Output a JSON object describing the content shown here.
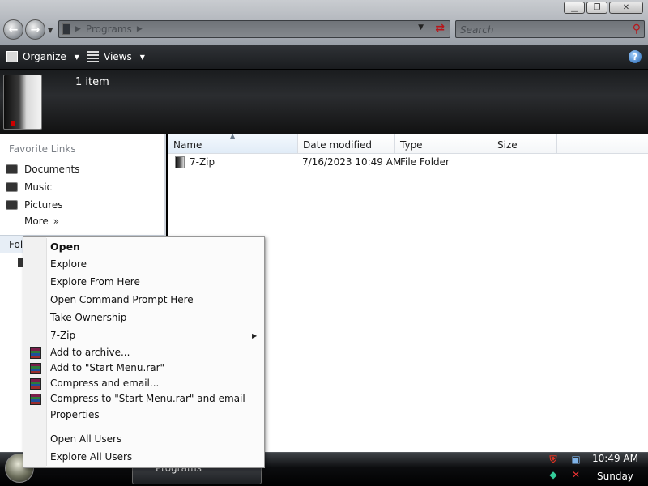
{
  "address": {
    "path": [
      "Programs"
    ],
    "search_placeholder": "Search"
  },
  "window_buttons": [
    "minimize",
    "restore",
    "close"
  ],
  "toolbar": {
    "organize_label": "Organize",
    "views_label": "Views"
  },
  "details": {
    "item_count": "1 item"
  },
  "navpane": {
    "favorites_title": "Favorite Links",
    "favorites": [
      {
        "label": "Documents",
        "icon": "documents-icon"
      },
      {
        "label": "Music",
        "icon": "music-icon"
      },
      {
        "label": "Pictures",
        "icon": "pictures-icon"
      }
    ],
    "more_label": "More",
    "more_glyph": "»",
    "folders_label": "Fol"
  },
  "filelist": {
    "columns": [
      "Name",
      "Date modified",
      "Type",
      "Size"
    ],
    "rows": [
      {
        "name": "7-Zip",
        "date_modified": "7/16/2023 10:49 AM",
        "type": "File Folder",
        "size": ""
      }
    ]
  },
  "context_menu": {
    "items": [
      {
        "label": "Open",
        "bold": true
      },
      {
        "label": "Explore"
      },
      {
        "label": "Explore From Here"
      },
      {
        "label": "Open Command Prompt Here"
      },
      {
        "label": "Take Ownership"
      },
      {
        "label": "7-Zip",
        "submenu": true
      },
      {
        "label": "Add to archive...",
        "icon": "winrar-icon"
      },
      {
        "label": "Add to \"Start Menu.rar\"",
        "icon": "winrar-icon"
      },
      {
        "label": "Compress and email...",
        "icon": "winrar-icon"
      },
      {
        "label": "Compress to \"Start Menu.rar\" and email",
        "icon": "winrar-icon"
      },
      {
        "label": "Properties"
      },
      {
        "label": "Open All Users"
      },
      {
        "label": "Explore All Users"
      }
    ]
  },
  "taskbar": {
    "task_button_label": "Programs",
    "clock_time": "10:49 AM",
    "clock_day": "Sunday"
  },
  "colors": {
    "taskbar": "#000000",
    "toolbar": "#1f2124",
    "menu_bg": "#fbfbfb"
  }
}
